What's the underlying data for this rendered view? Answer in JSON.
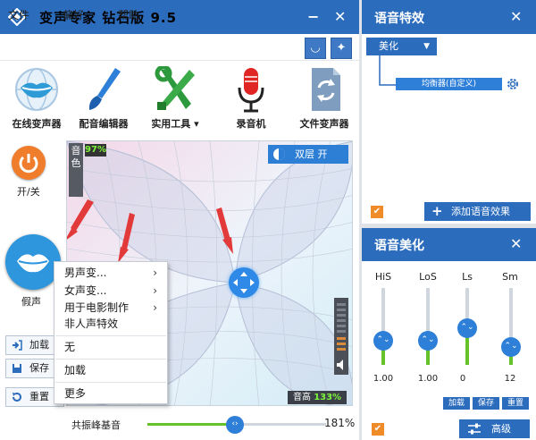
{
  "main_window": {
    "title": "变声专家 钻石版 9.5",
    "minimize": "−",
    "close": "✕",
    "menu": [
      "文件",
      "偏好",
      "帮助"
    ],
    "toolbar": [
      {
        "label": "在线变声器",
        "icon": "lips-globe-icon"
      },
      {
        "label": "配音编辑器",
        "icon": "brush-icon"
      },
      {
        "label": "实用工具 ▾",
        "icon": "tools-icon"
      },
      {
        "label": "录音机",
        "icon": "microphone-icon"
      },
      {
        "label": "文件变声器",
        "icon": "file-refresh-icon"
      }
    ],
    "power_label": "开/关",
    "voice_label": "假声",
    "side_buttons": [
      "加载",
      "保存",
      "重置"
    ],
    "pad": {
      "timbre_label": "音色",
      "timbre_value": "97%",
      "double_layer": "双层 开",
      "pitch_label": "音高",
      "pitch_value": "133%"
    },
    "context_menu": {
      "items": [
        {
          "label": "男声变...",
          "arrow": "›"
        },
        {
          "label": "女声变...",
          "arrow": "›"
        },
        {
          "label": "用于电影制作",
          "arrow": "›"
        },
        {
          "label": "非人声特效",
          "arrow": ""
        },
        {
          "label": "无",
          "arrow": ""
        },
        {
          "label": "加载",
          "arrow": ""
        },
        {
          "label": "更多",
          "arrow": ""
        }
      ]
    },
    "resonance": {
      "label": "共振峰基音",
      "value_text": "181%",
      "fraction": 0.49
    }
  },
  "effects_window": {
    "title": "语音特效",
    "close": "✕",
    "dropdown": "美化",
    "chip": "均衡器(自定义)",
    "add_button": "添加语音效果",
    "checked": true
  },
  "beautify_window": {
    "title": "语音美化",
    "close": "✕",
    "sliders": [
      {
        "label": "HiS",
        "value": "1.00",
        "level": 0.35
      },
      {
        "label": "LoS",
        "value": "1.00",
        "level": 0.35
      },
      {
        "label": "Ls",
        "value": "0",
        "level": 0.45
      },
      {
        "label": "Sm",
        "value": "12",
        "level": 0.15
      }
    ],
    "buttons": [
      "加载",
      "保存",
      "重置"
    ],
    "advanced": "高级",
    "checked": true
  },
  "colors": {
    "titlebar": "#2b6cbd",
    "accent_green": "#66c22a",
    "orange": "#f07d2b",
    "red_arrow": "#e23a3a"
  }
}
